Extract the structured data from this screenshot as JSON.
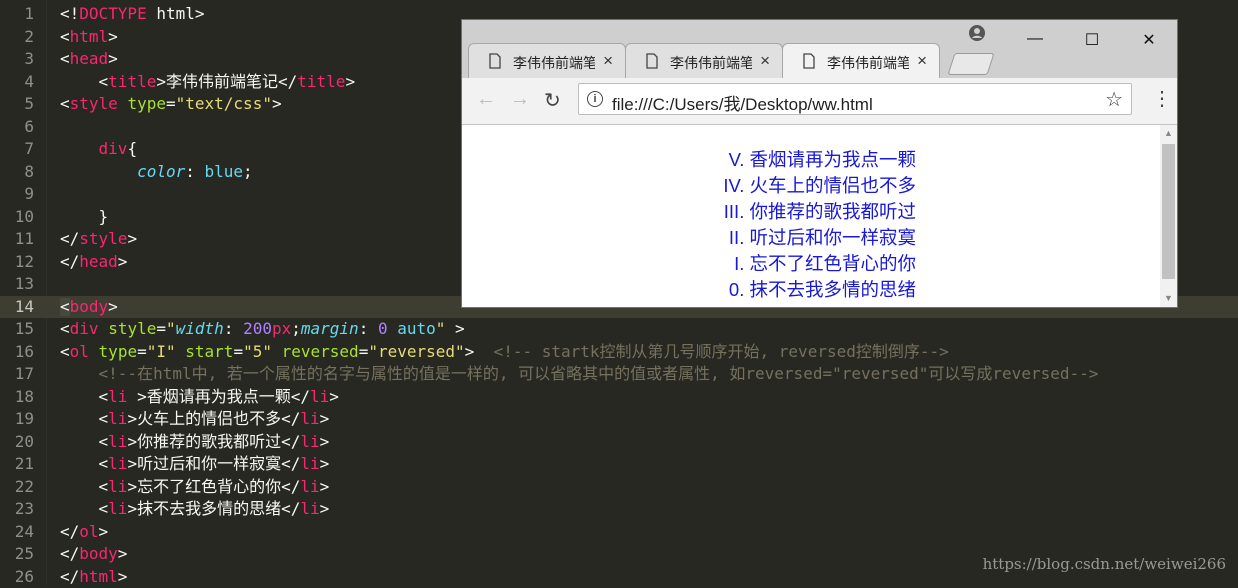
{
  "editor": {
    "active_line": 14,
    "lines": [
      {
        "n": "1",
        "segs": [
          [
            "punc",
            "<!"
          ],
          [
            "doctype",
            "DOCTYPE"
          ],
          [
            "txt",
            " html>"
          ]
        ]
      },
      {
        "n": "2",
        "segs": [
          [
            "punc",
            "<"
          ],
          [
            "tag",
            "html"
          ],
          [
            "punc",
            ">"
          ]
        ]
      },
      {
        "n": "3",
        "segs": [
          [
            "punc",
            "<"
          ],
          [
            "tag",
            "head"
          ],
          [
            "punc",
            ">"
          ]
        ]
      },
      {
        "n": "4",
        "segs": [
          [
            "txt",
            "    <"
          ],
          [
            "tag",
            "title"
          ],
          [
            "punc",
            ">"
          ],
          [
            "txt",
            "李伟伟前端笔记"
          ],
          [
            "punc",
            "</"
          ],
          [
            "tag",
            "title"
          ],
          [
            "punc",
            ">"
          ]
        ]
      },
      {
        "n": "5",
        "segs": [
          [
            "punc",
            "<"
          ],
          [
            "tag",
            "style"
          ],
          [
            "txt",
            " "
          ],
          [
            "attr",
            "type"
          ],
          [
            "punc",
            "="
          ],
          [
            "str",
            "\"text/css\""
          ],
          [
            "punc",
            ">"
          ]
        ]
      },
      {
        "n": "6",
        "segs": []
      },
      {
        "n": "7",
        "segs": [
          [
            "txt",
            "    "
          ],
          [
            "tag",
            "div"
          ],
          [
            "punc",
            "{"
          ]
        ]
      },
      {
        "n": "8",
        "segs": [
          [
            "txt",
            "        "
          ],
          [
            "kw",
            "color"
          ],
          [
            "punc",
            ": "
          ],
          [
            "kw2",
            "blue"
          ],
          [
            "punc",
            ";"
          ]
        ]
      },
      {
        "n": "9",
        "segs": []
      },
      {
        "n": "10",
        "segs": [
          [
            "txt",
            "    }"
          ]
        ]
      },
      {
        "n": "11",
        "segs": [
          [
            "punc",
            "</"
          ],
          [
            "tag",
            "style"
          ],
          [
            "punc",
            ">"
          ]
        ]
      },
      {
        "n": "12",
        "segs": [
          [
            "punc",
            "</"
          ],
          [
            "tag",
            "head"
          ],
          [
            "punc",
            ">"
          ]
        ]
      },
      {
        "n": "13",
        "segs": []
      },
      {
        "n": "14",
        "segs": [
          [
            "punc",
            "<"
          ],
          [
            "tag",
            "body"
          ],
          [
            "punc",
            ">"
          ]
        ]
      },
      {
        "n": "15",
        "segs": [
          [
            "punc",
            "<"
          ],
          [
            "tag",
            "div"
          ],
          [
            "txt",
            " "
          ],
          [
            "attr",
            "style"
          ],
          [
            "punc",
            "="
          ],
          [
            "str",
            "\""
          ],
          [
            "kw",
            "width"
          ],
          [
            "punc",
            ": "
          ],
          [
            "num",
            "200"
          ],
          [
            "tag",
            "px"
          ],
          [
            "punc",
            ";"
          ],
          [
            "kw",
            "margin"
          ],
          [
            "punc",
            ": "
          ],
          [
            "num",
            "0"
          ],
          [
            "txt",
            " "
          ],
          [
            "kw2",
            "auto"
          ],
          [
            "str",
            "\""
          ],
          [
            "punc",
            " >"
          ]
        ]
      },
      {
        "n": "16",
        "segs": [
          [
            "punc",
            "<"
          ],
          [
            "tag",
            "ol"
          ],
          [
            "txt",
            " "
          ],
          [
            "attr",
            "type"
          ],
          [
            "punc",
            "="
          ],
          [
            "str",
            "\"I\""
          ],
          [
            "txt",
            " "
          ],
          [
            "attr",
            "start"
          ],
          [
            "punc",
            "="
          ],
          [
            "str",
            "\"5\""
          ],
          [
            "txt",
            " "
          ],
          [
            "attr",
            "reversed"
          ],
          [
            "punc",
            "="
          ],
          [
            "str",
            "\"reversed\""
          ],
          [
            "punc",
            ">"
          ],
          [
            "cmt",
            "  <!-- startk控制从第几号顺序开始, reversed控制倒序-->"
          ]
        ]
      },
      {
        "n": "17",
        "segs": [
          [
            "cmt",
            "    <!--在html中, 若一个属性的名字与属性的值是一样的, 可以省略其中的值或者属性, 如reversed=\"reversed\"可以写成reversed-->"
          ]
        ]
      },
      {
        "n": "18",
        "segs": [
          [
            "txt",
            "    <"
          ],
          [
            "tag",
            "li"
          ],
          [
            "txt",
            " >香烟请再为我点一颗</"
          ],
          [
            "tag",
            "li"
          ],
          [
            "punc",
            ">"
          ]
        ]
      },
      {
        "n": "19",
        "segs": [
          [
            "txt",
            "    <"
          ],
          [
            "tag",
            "li"
          ],
          [
            "punc",
            ">"
          ],
          [
            "txt",
            "火车上的情侣也不多</"
          ],
          [
            "tag",
            "li"
          ],
          [
            "punc",
            ">"
          ]
        ]
      },
      {
        "n": "20",
        "segs": [
          [
            "txt",
            "    <"
          ],
          [
            "tag",
            "li"
          ],
          [
            "punc",
            ">"
          ],
          [
            "txt",
            "你推荐的歌我都听过</"
          ],
          [
            "tag",
            "li"
          ],
          [
            "punc",
            ">"
          ]
        ]
      },
      {
        "n": "21",
        "segs": [
          [
            "txt",
            "    <"
          ],
          [
            "tag",
            "li"
          ],
          [
            "punc",
            ">"
          ],
          [
            "txt",
            "听过后和你一样寂寞</"
          ],
          [
            "tag",
            "li"
          ],
          [
            "punc",
            ">"
          ]
        ]
      },
      {
        "n": "22",
        "segs": [
          [
            "txt",
            "    <"
          ],
          [
            "tag",
            "li"
          ],
          [
            "punc",
            ">"
          ],
          [
            "txt",
            "忘不了红色背心的你</"
          ],
          [
            "tag",
            "li"
          ],
          [
            "punc",
            ">"
          ]
        ]
      },
      {
        "n": "23",
        "segs": [
          [
            "txt",
            "    <"
          ],
          [
            "tag",
            "li"
          ],
          [
            "punc",
            ">"
          ],
          [
            "txt",
            "抹不去我多情的思绪</"
          ],
          [
            "tag",
            "li"
          ],
          [
            "punc",
            ">"
          ]
        ]
      },
      {
        "n": "24",
        "segs": [
          [
            "punc",
            "</"
          ],
          [
            "tag",
            "ol"
          ],
          [
            "punc",
            ">"
          ]
        ]
      },
      {
        "n": "25",
        "segs": [
          [
            "punc",
            "</"
          ],
          [
            "tag",
            "body"
          ],
          [
            "punc",
            ">"
          ]
        ]
      },
      {
        "n": "26",
        "segs": [
          [
            "punc",
            "</"
          ],
          [
            "tag",
            "html"
          ],
          [
            "punc",
            ">"
          ]
        ]
      }
    ],
    "watermark": "https://blog.csdn.net/weiwei266"
  },
  "browser": {
    "tabs": [
      {
        "title": "李伟伟前端笔记",
        "close": "×",
        "active": false
      },
      {
        "title": "李伟伟前端笔记",
        "close": "×",
        "active": false
      },
      {
        "title": "李伟伟前端笔记",
        "close": "×",
        "active": true
      }
    ],
    "window_controls": {
      "minimize": "—",
      "maximize": "☐",
      "close": "✕"
    },
    "nav": {
      "back": "←",
      "forward": "→",
      "reload": "↻"
    },
    "address": {
      "info_icon": "i",
      "url": "file:///C:/Users/我/Desktop/ww.html",
      "star": "☆"
    },
    "menu": "⋮",
    "list": [
      {
        "marker": "V.",
        "text": "香烟请再为我点一颗"
      },
      {
        "marker": "IV.",
        "text": "火车上的情侣也不多"
      },
      {
        "marker": "III.",
        "text": "你推荐的歌我都听过"
      },
      {
        "marker": "II.",
        "text": "听过后和你一样寂寞"
      },
      {
        "marker": "I.",
        "text": "忘不了红色背心的你"
      },
      {
        "marker": "0.",
        "text": "抹不去我多情的思绪"
      }
    ],
    "colors": {
      "list_text": "#1818d8",
      "window_border": "#3c7fb1"
    }
  }
}
